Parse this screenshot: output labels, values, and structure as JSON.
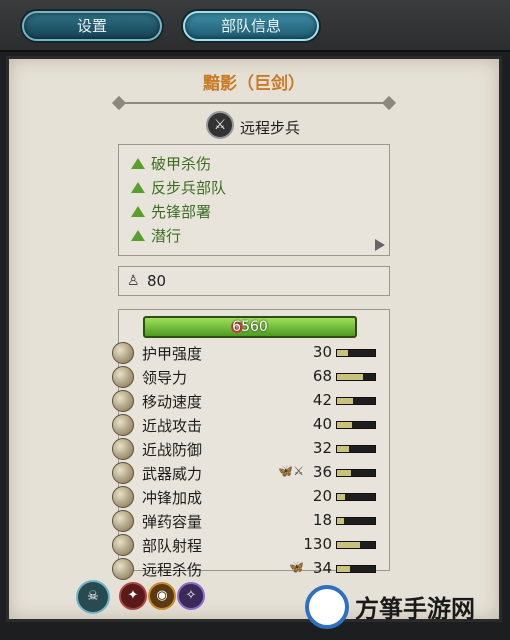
{
  "tabs": [
    {
      "label": "设置",
      "active": false
    },
    {
      "label": "部队信息",
      "active": true
    }
  ],
  "unit": {
    "name": "黯影（巨剑）",
    "class_label": "远程步兵",
    "class_icon": "sword-icon"
  },
  "abilities": [
    {
      "label": "破甲杀伤"
    },
    {
      "label": "反步兵部队"
    },
    {
      "label": "先锋部署"
    },
    {
      "label": "潜行"
    }
  ],
  "men": {
    "icon": "soldier-icon",
    "value": "80"
  },
  "hp": {
    "value": "6560",
    "fraction": 1.0
  },
  "stats": [
    {
      "label": "护甲强度",
      "value": "30",
      "fraction": 0.3,
      "icon": "armor-icon"
    },
    {
      "label": "领导力",
      "value": "68",
      "fraction": 0.68,
      "icon": "leadership-icon"
    },
    {
      "label": "移动速度",
      "value": "42",
      "fraction": 0.42,
      "icon": "speed-icon"
    },
    {
      "label": "近战攻击",
      "value": "40",
      "fraction": 0.4,
      "icon": "melee-attack-icon"
    },
    {
      "label": "近战防御",
      "value": "32",
      "fraction": 0.32,
      "icon": "melee-defence-icon"
    },
    {
      "label": "武器威力",
      "value": "36",
      "fraction": 0.36,
      "icon": "weapon-strength-icon",
      "extra": "🦋⚔"
    },
    {
      "label": "冲锋加成",
      "value": "20",
      "fraction": 0.2,
      "icon": "charge-bonus-icon"
    },
    {
      "label": "弹药容量",
      "value": "18",
      "fraction": 0.18,
      "icon": "ammunition-icon"
    },
    {
      "label": "部队射程",
      "value": "130",
      "fraction": 0.6,
      "icon": "range-icon"
    },
    {
      "label": "远程杀伤",
      "value": "34",
      "fraction": 0.34,
      "icon": "missile-damage-icon",
      "extra": "🦋"
    }
  ],
  "bottom_icons": [
    "unit-type-icon",
    "attribute-red-icon",
    "attribute-gold-icon",
    "attribute-purple-icon"
  ],
  "watermark": {
    "text": "方箏手游网"
  }
}
